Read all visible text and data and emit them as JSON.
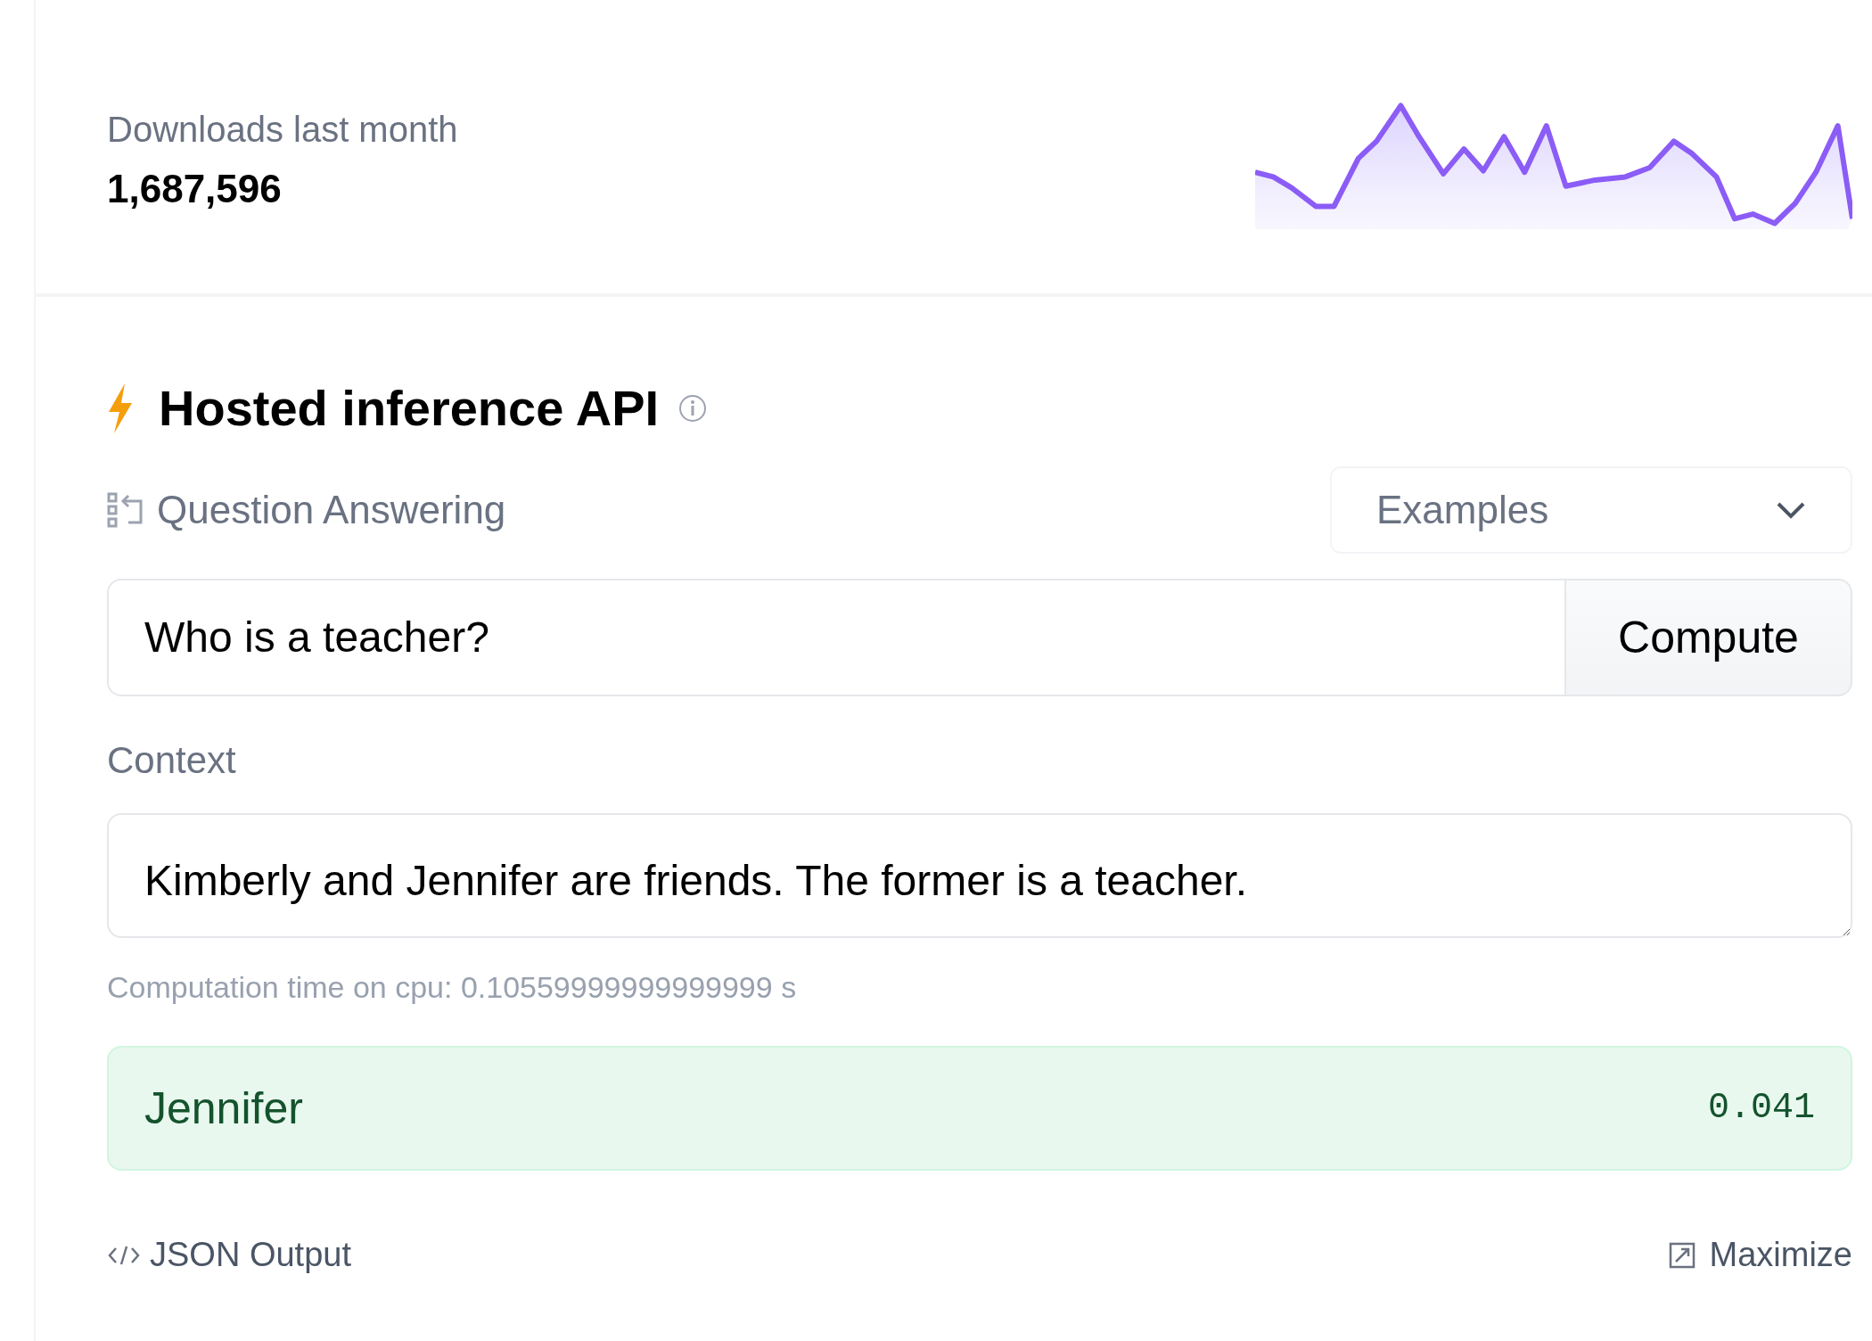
{
  "downloads": {
    "label": "Downloads last month",
    "value": "1,687,596"
  },
  "widget": {
    "title": "Hosted inference API",
    "task": "Question Answering",
    "examples": {
      "placeholder": "Examples"
    },
    "question": {
      "value": "Who is a teacher?"
    },
    "compute_button": "Compute",
    "context_label": "Context",
    "context": {
      "value": "Kimberly and Jennifer are friends. The former is a teacher."
    },
    "computation_time": "Computation time on cpu: 0.10559999999999999 s",
    "result": {
      "answer": "Jennifer",
      "score": "0.041"
    },
    "json_output": "JSON Output",
    "maximize": "Maximize"
  }
}
